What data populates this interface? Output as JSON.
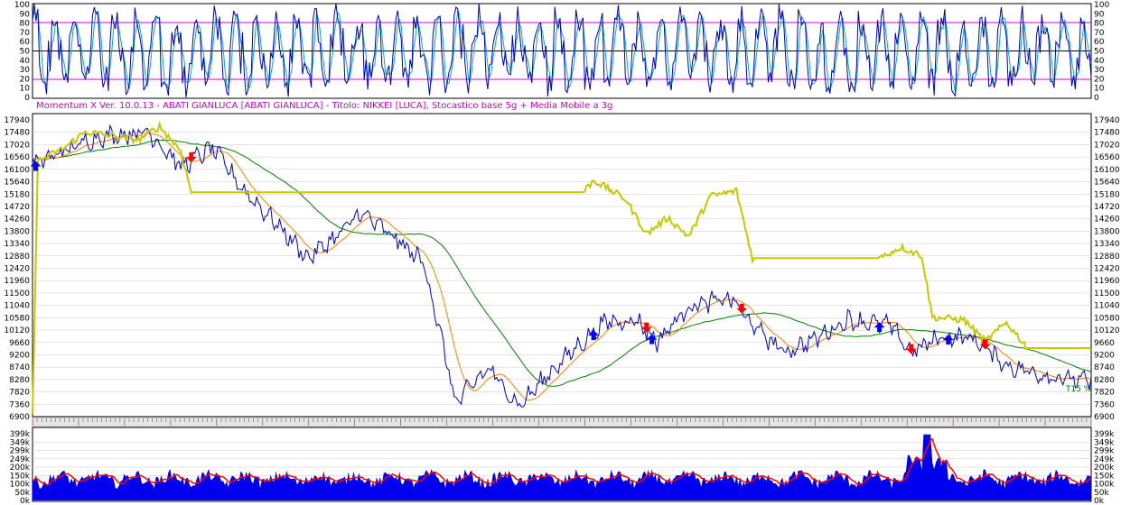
{
  "header": {
    "title": "Momentum X  Ver. 10.0.13  -  ABATI GIANLUCA  [ABATI GIANLUCA] - Titolo: NIKKEI  [LUCA],    Stocastico base 5g + Media Mobile a 3g"
  },
  "colors": {
    "price": "#0000cc",
    "ma_short": "#ff8000",
    "ma_long": "#008000",
    "equity": "#c8c800",
    "volume_fill": "#0000ee",
    "volume_line": "#ff0000",
    "osc_main": "#0000bb",
    "osc_signal": "#00aacc",
    "osc_band": "#cc00cc",
    "buy_arrow": "#0000ff",
    "sell_arrow": "#ff0000"
  },
  "chart_data": [
    {
      "type": "line",
      "name": "oscillator",
      "yticks": [
        "100",
        "90",
        "80",
        "70",
        "60",
        "50",
        "40",
        "30",
        "20",
        "10",
        "0"
      ],
      "ylim": [
        0,
        100
      ],
      "bands": [
        20,
        50,
        80
      ]
    },
    {
      "type": "line",
      "name": "price",
      "yticks": [
        "17940",
        "17480",
        "17020",
        "16560",
        "16100",
        "15640",
        "15180",
        "14720",
        "14260",
        "13800",
        "13340",
        "12880",
        "12420",
        "11960",
        "11500",
        "11040",
        "10580",
        "10120",
        "9660",
        "9200",
        "8740",
        "8280",
        "7820",
        "7360",
        "6900"
      ],
      "ylim": [
        6900,
        17940
      ],
      "price_keys": [
        [
          0,
          16300
        ],
        [
          0.02,
          16600
        ],
        [
          0.06,
          17300
        ],
        [
          0.11,
          17500
        ],
        [
          0.14,
          16200
        ],
        [
          0.17,
          16900
        ],
        [
          0.2,
          15300
        ],
        [
          0.23,
          14100
        ],
        [
          0.26,
          12800
        ],
        [
          0.29,
          13700
        ],
        [
          0.31,
          14500
        ],
        [
          0.34,
          13600
        ],
        [
          0.37,
          12600
        ],
        [
          0.4,
          7400
        ],
        [
          0.43,
          8700
        ],
        [
          0.46,
          7300
        ],
        [
          0.49,
          8600
        ],
        [
          0.52,
          9700
        ],
        [
          0.54,
          10400
        ],
        [
          0.57,
          10500
        ],
        [
          0.59,
          9700
        ],
        [
          0.62,
          11000
        ],
        [
          0.66,
          11300
        ],
        [
          0.68,
          10300
        ],
        [
          0.71,
          9300
        ],
        [
          0.74,
          9800
        ],
        [
          0.77,
          10500
        ],
        [
          0.81,
          10300
        ],
        [
          0.83,
          9300
        ],
        [
          0.86,
          9900
        ],
        [
          0.89,
          9800
        ],
        [
          0.92,
          8800
        ],
        [
          0.96,
          8400
        ],
        [
          1,
          8200
        ]
      ],
      "equity_keys": [
        [
          0,
          6900
        ],
        [
          0.005,
          16400
        ],
        [
          0.03,
          16900
        ],
        [
          0.05,
          17500
        ],
        [
          0.1,
          17200
        ],
        [
          0.12,
          17700
        ],
        [
          0.14,
          16800
        ],
        [
          0.15,
          15250
        ],
        [
          0.52,
          15250
        ],
        [
          0.53,
          15700
        ],
        [
          0.56,
          15000
        ],
        [
          0.58,
          13700
        ],
        [
          0.6,
          14300
        ],
        [
          0.62,
          13600
        ],
        [
          0.64,
          15100
        ],
        [
          0.665,
          15300
        ],
        [
          0.68,
          12800
        ],
        [
          0.8,
          12800
        ],
        [
          0.82,
          13200
        ],
        [
          0.84,
          12900
        ],
        [
          0.85,
          10600
        ],
        [
          0.88,
          10500
        ],
        [
          0.9,
          9700
        ],
        [
          0.92,
          10400
        ],
        [
          0.94,
          9450
        ],
        [
          1,
          9450
        ]
      ],
      "buy_signals": [
        0.003,
        0.53,
        0.585,
        0.8,
        0.865
      ],
      "sell_signals": [
        0.15,
        0.58,
        0.67,
        0.83,
        0.9
      ],
      "annotation": "T15 %"
    },
    {
      "type": "bar",
      "name": "volume",
      "yticks": [
        "399k",
        "349k",
        "299k",
        "249k",
        "200k",
        "150k",
        "100k",
        "50k",
        "0k"
      ],
      "ylim": [
        0,
        399
      ],
      "spike_at": 0.845
    }
  ]
}
